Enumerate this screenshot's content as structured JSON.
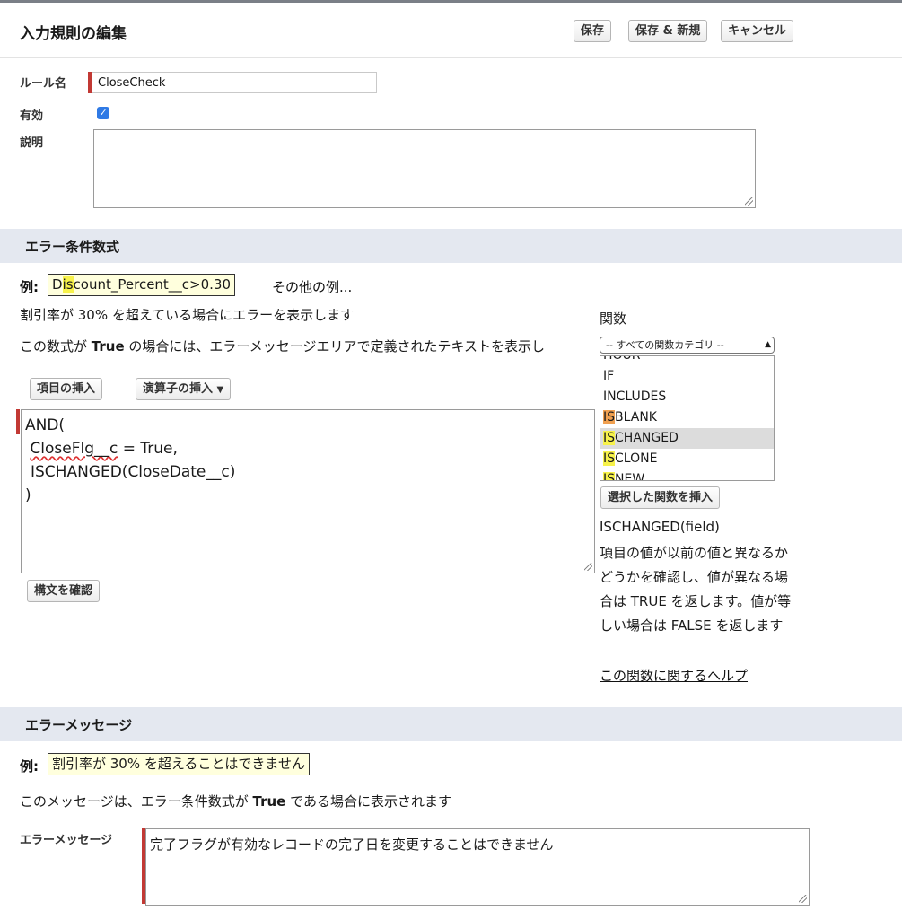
{
  "header": {
    "title": "入力規則の編集",
    "save": "保存",
    "save_new": "保存 & 新規",
    "cancel": "キャンセル"
  },
  "rule": {
    "name_label": "ルール名",
    "name_value": "CloseCheck",
    "active_label": "有効",
    "active_checked": true,
    "description_label": "説明",
    "description_value": ""
  },
  "formula_section": {
    "title": "エラー条件数式",
    "example_label": "例:",
    "example_pre": "D",
    "example_hl": "is",
    "example_post": "count_Percent__c>0.30",
    "more_examples": "その他の例...",
    "example_desc": "割引率が 30% を超えている場合にエラーを表示します",
    "info_pre": "この数式が ",
    "info_bold": "True",
    "info_post": " の場合には、エラーメッセージエリアで定義されたテキストを表示し",
    "insert_field": "項目の挿入",
    "insert_operator": "演算子の挿入",
    "formula_lines": [
      "AND(",
      " ",
      "ISCHANGED(CloseDate__c)",
      ")"
    ],
    "formula_line2_err": "CloseFlg__c",
    "formula_line2_rest": " = True,",
    "check_syntax": "構文を確認"
  },
  "functions": {
    "label": "関数",
    "category": "-- すべての関数カテゴリ --",
    "items": [
      {
        "hl": "",
        "rest": "HOUR"
      },
      {
        "hl": "",
        "rest": "IF"
      },
      {
        "hl": "",
        "rest": "INCLUDES"
      },
      {
        "hl": "IS",
        "rest": "BLANK"
      },
      {
        "hl": "IS",
        "rest": "CHANGED"
      },
      {
        "hl": "IS",
        "rest": "CLONE"
      },
      {
        "hl": "IS",
        "rest": "NEW"
      }
    ],
    "selected_index": 4,
    "insert_button": "選択した関数を挿入",
    "signature": "ISCHANGED(field)",
    "desc_lines": [
      "項目の値が以前の値と異なるか",
      "どうかを確認し、値が異なる場",
      "合は TRUE を返します。値が等",
      "しい場合は FALSE を返します"
    ],
    "help_link": "この関数に関するヘルプ"
  },
  "message_section": {
    "title": "エラーメッセージ",
    "example_label": "例:",
    "example_value": "割引率が 30% を超えることはできません",
    "info_pre": "このメッセージは、エラー条件数式が ",
    "info_bold": "True",
    "info_post": " である場合に表示されます",
    "field_label": "エラーメッセージ",
    "field_value": "完了フラグが有効なレコードの完了日を変更することはできません"
  },
  "colors": {
    "section_band": "#e4e8f0",
    "required_bar": "#c23934",
    "checkbox": "#2f7ae5",
    "highlight": "#f7f24a",
    "example_bg": "#ffffdd"
  }
}
